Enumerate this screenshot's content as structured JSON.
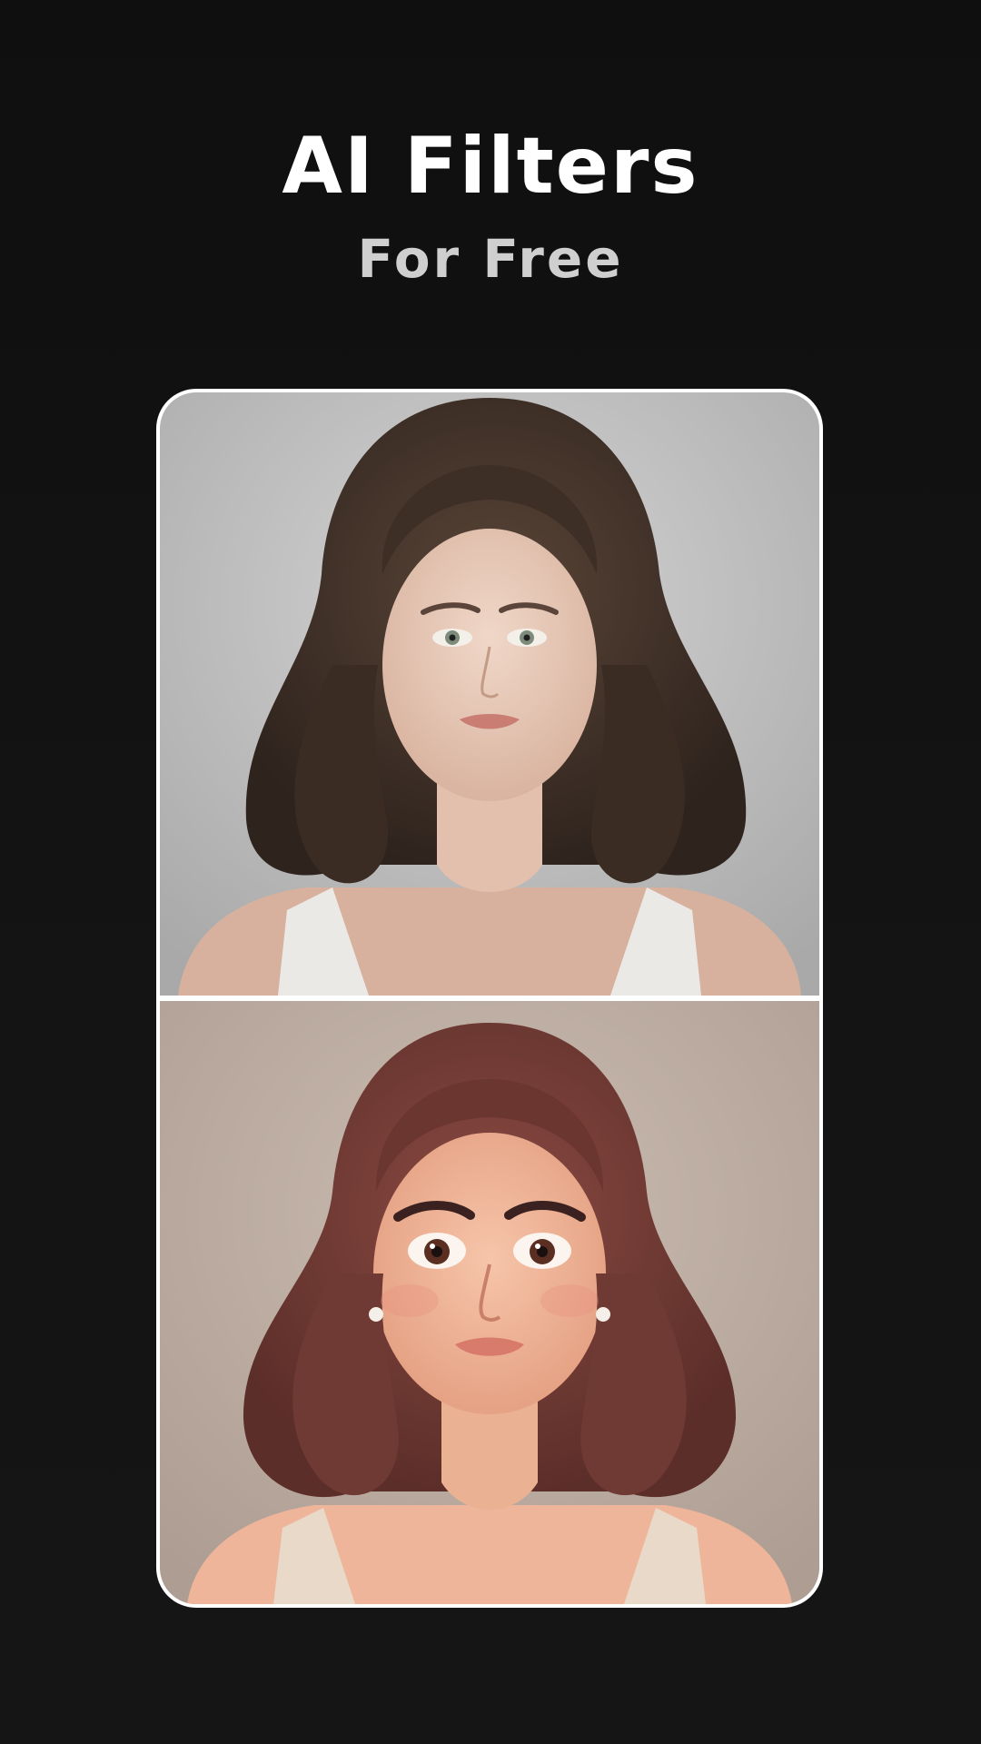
{
  "header": {
    "title": "AI Filters",
    "subtitle": "For Free"
  },
  "comparison": {
    "before": {
      "description_icon": "portrait-photo"
    },
    "after": {
      "description_icon": "portrait-cartoon"
    }
  },
  "colors": {
    "background": "#121212",
    "title": "#ffffff",
    "subtitle": "#cfcfcf",
    "card_border": "#ffffff"
  }
}
